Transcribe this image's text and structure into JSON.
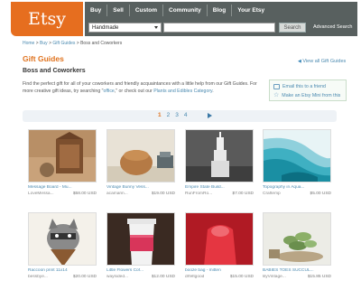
{
  "header": {
    "logo": "Etsy",
    "nav": [
      "Buy",
      "Sell",
      "Custom",
      "Community",
      "Blog",
      "Your Etsy"
    ],
    "search": {
      "category": "Handmade",
      "value": "",
      "button": "Search",
      "advanced": "Advanced Search"
    }
  },
  "breadcrumb": {
    "home": "Home",
    "buy": "Buy",
    "gift_guides": "Gift Guides",
    "current": "Boss and Coworkers",
    "sep": ">"
  },
  "page": {
    "title": "Gift Guides",
    "view_all": "View all Gift Guides",
    "subtitle": "Boss and Coworkers",
    "desc_1": "Find the perfect gift for all of your coworkers and friendly acquaintances with a little help from our Gift Guides. For more creative gift ideas, try searching \"",
    "desc_link_1": "office",
    "desc_2": ",\" or check out our ",
    "desc_link_2": "Plants and Edibles Category",
    "desc_3": "."
  },
  "share": {
    "email": "Email this to a friend",
    "mini": "Make an Etsy Mini from this"
  },
  "pagination": {
    "pages": [
      "1",
      "2",
      "3",
      "4"
    ],
    "active": "1"
  },
  "items": [
    {
      "title": "Message Board - Mu...",
      "seller": "LoveMessa...",
      "price": "$58.00 USD"
    },
    {
      "title": "Vintage Bunny Vess...",
      "seller": "acamarin...",
      "price": "$19.00 USD"
    },
    {
      "title": "Empire State Build...",
      "seller": "RunFromRo...",
      "price": "$7.00 USD"
    },
    {
      "title": "Topography in Aqua...",
      "seller": "Craftemp",
      "price": "$5.00 USD"
    },
    {
      "title": "Raccoon print 11x14",
      "seller": "bessbye...",
      "price": "$20.00 USD"
    },
    {
      "title": "Little Flowers Cof...",
      "seller": "waysided...",
      "price": "$12.00 USD"
    },
    {
      "title": "booze bag - mitten",
      "seller": "drfeltgood",
      "price": "$15.00 USD"
    },
    {
      "title": "BABIES TOES SUCCUL...",
      "seller": "lilyVintage...",
      "price": "$15.85 USD"
    }
  ],
  "colors": {
    "accent": "#e66e1f",
    "nav_bg": "#58605f",
    "link": "#4b8ab0"
  }
}
